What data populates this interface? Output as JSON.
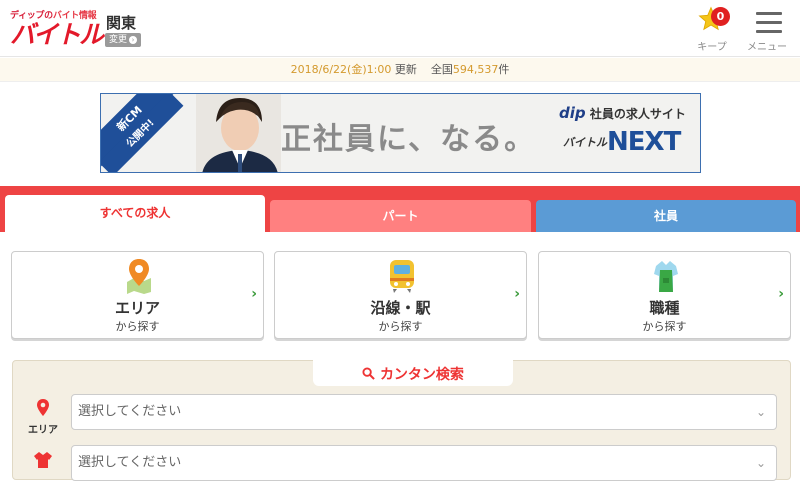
{
  "header": {
    "logo_tagline_prefix": "ディップの",
    "logo_tagline_accent": "バイト情報",
    "logo_main": "バイトル",
    "region": "関東",
    "change_label": "変更",
    "keep_label": "キープ",
    "keep_count": "0",
    "menu_label": "メニュー"
  },
  "update_bar": {
    "datetime": "2018/6/22(金)1:00",
    "updated_label": "更新",
    "nationwide_label": "全国",
    "count": "594,537",
    "count_unit": "件"
  },
  "banner": {
    "ribbon_line1": "新CM",
    "ribbon_line2": "公開中!",
    "headline": "正社員に、なる。",
    "brand_dip": "dip",
    "brand_text": "社員の求人サイト",
    "logo_prefix": "バイトル",
    "logo_next": "NEXT"
  },
  "tabs": [
    {
      "label": "すべての求人",
      "active": true
    },
    {
      "label": "パート",
      "active": false
    },
    {
      "label": "社員",
      "active": false
    }
  ],
  "cards": [
    {
      "icon": "map-pin-icon",
      "title": "エリア",
      "sub": "から探す"
    },
    {
      "icon": "train-icon",
      "title": "沿線・駅",
      "sub": "から探す"
    },
    {
      "icon": "apron-icon",
      "title": "職種",
      "sub": "から探す"
    }
  ],
  "easy_search": {
    "title": "カンタン検索",
    "area_label": "エリア",
    "area_placeholder": "選択してください",
    "job_placeholder": "選択してください"
  },
  "colors": {
    "brand_red": "#e3192a",
    "tab_part": "#ff8080",
    "tab_shain": "#5b9bd5",
    "arrow_green": "#3a9b3a"
  }
}
